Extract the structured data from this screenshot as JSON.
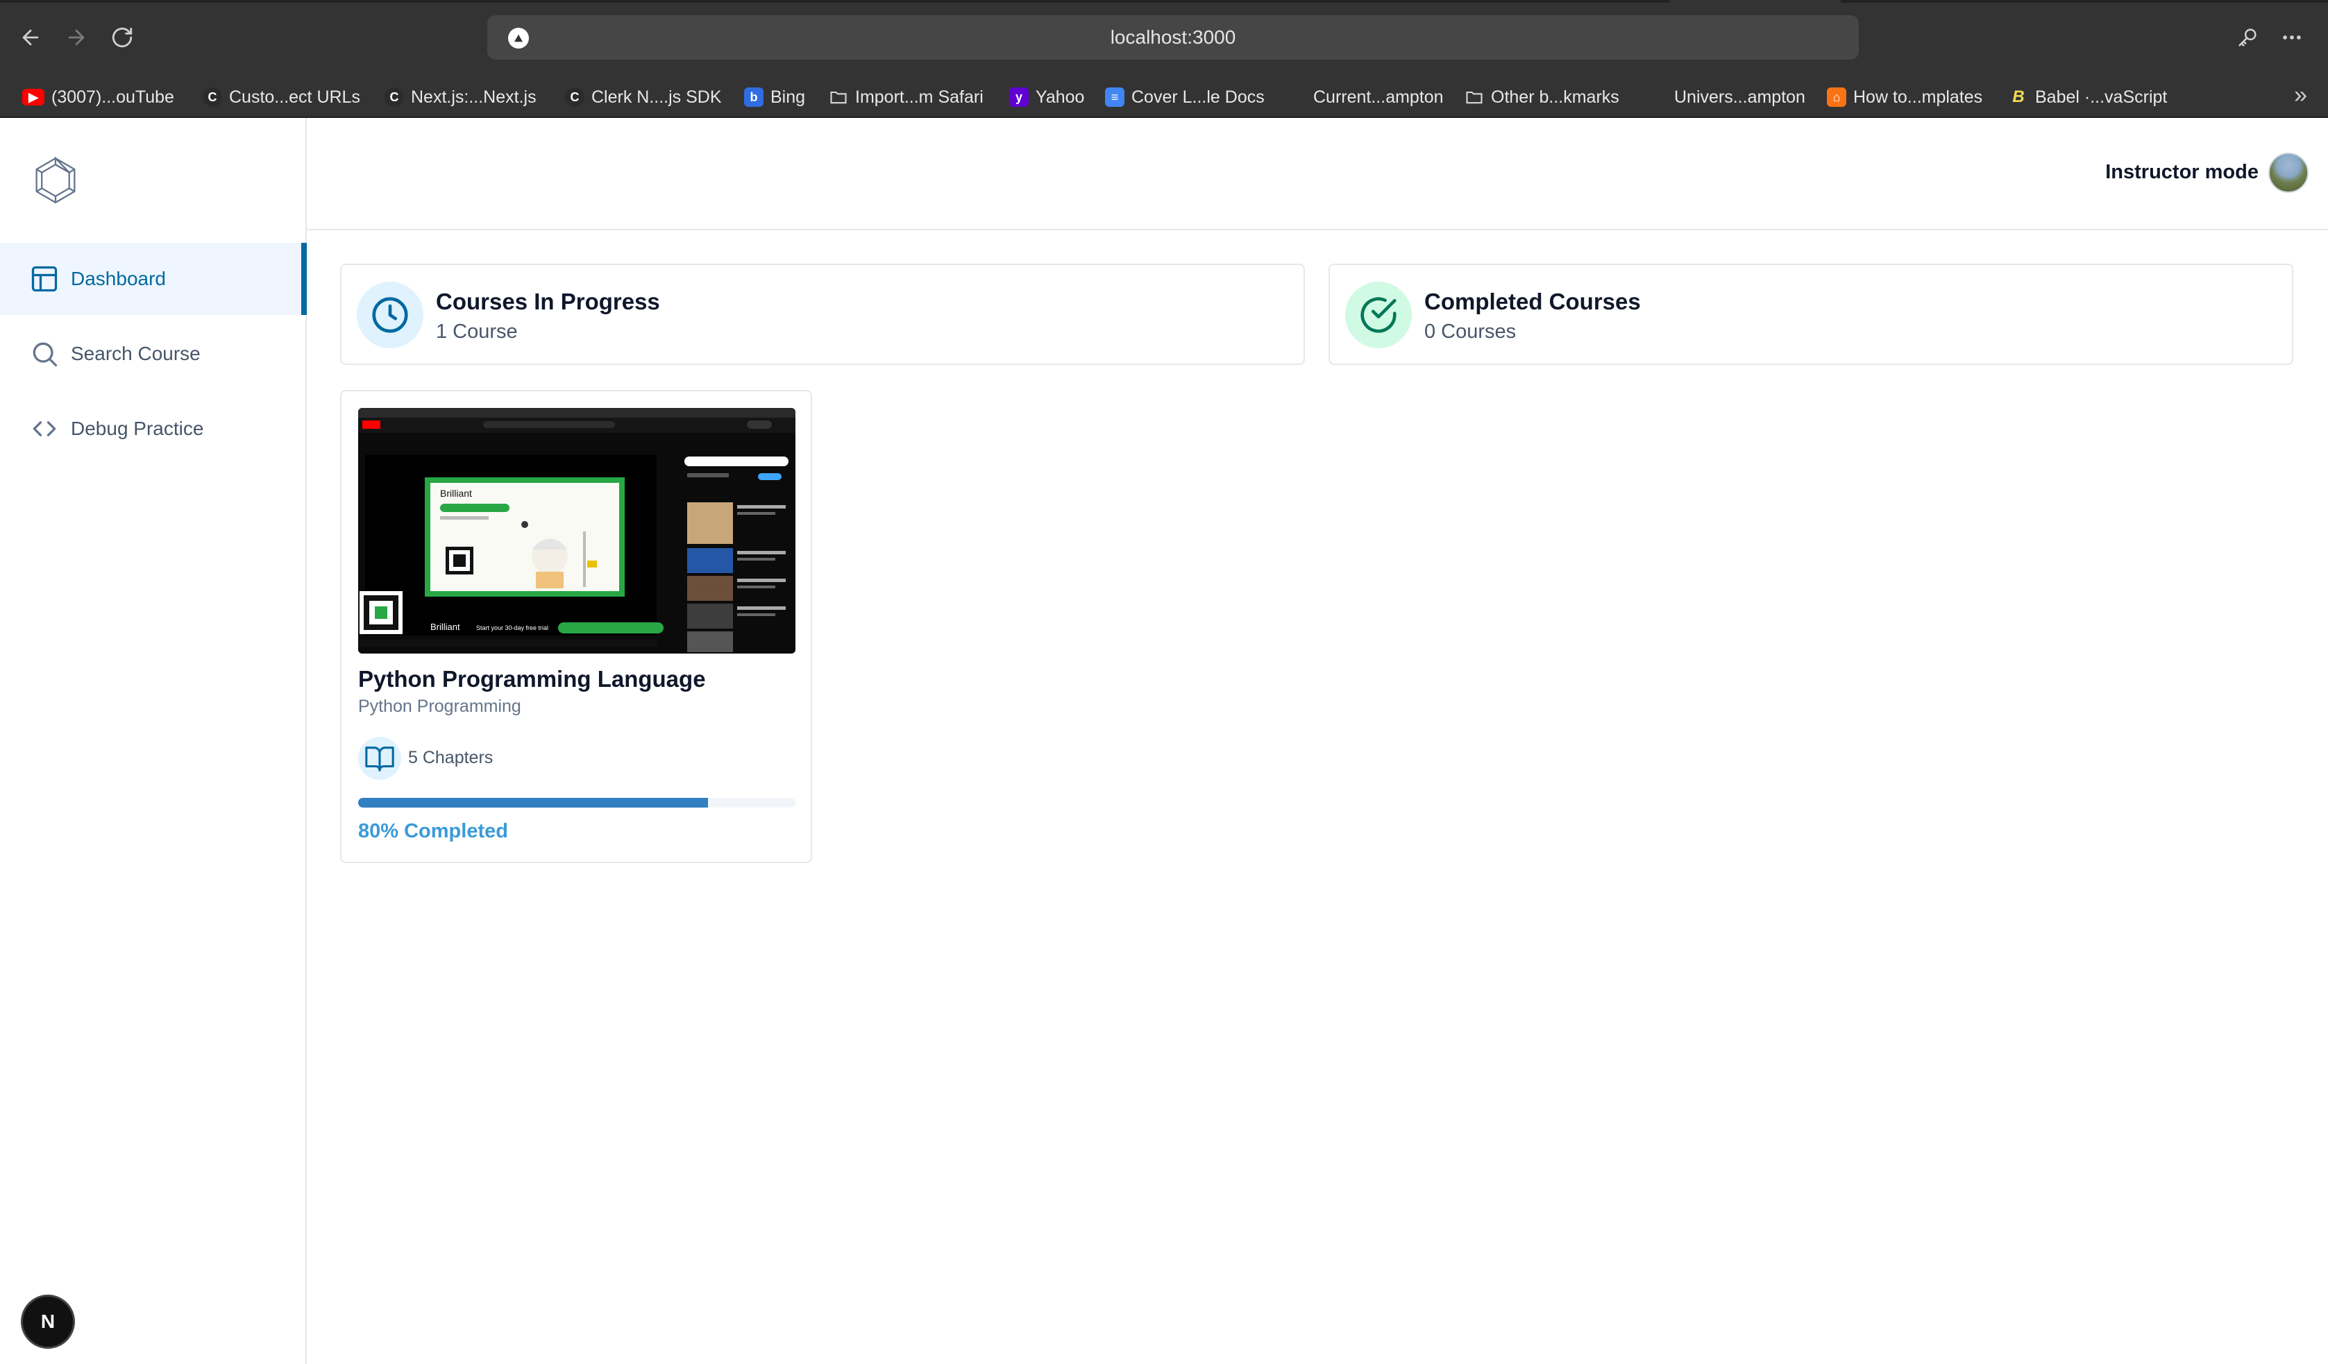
{
  "browser": {
    "url": "localhost:3000",
    "bookmarks": [
      {
        "label": "(3007)...ouTube",
        "icon": "youtube-icon",
        "color": "#ff0000"
      },
      {
        "label": "Custo...ect URLs",
        "icon": "clerk-icon",
        "color": "#444444"
      },
      {
        "label": "Next.js:...Next.js",
        "icon": "clerk-icon",
        "color": "#444444"
      },
      {
        "label": "Clerk N....js SDK",
        "icon": "clerk-icon",
        "color": "#444444"
      },
      {
        "label": "Bing",
        "icon": "bing-icon",
        "color": "#2f6de0"
      },
      {
        "label": "Import...m Safari",
        "icon": "folder-icon",
        "color": ""
      },
      {
        "label": "Yahoo",
        "icon": "yahoo-icon",
        "color": "#6001d2"
      },
      {
        "label": "Cover L...le Docs",
        "icon": "docs-icon",
        "color": "#4285f4"
      },
      {
        "label": "Current...ampton",
        "icon": "",
        "color": ""
      },
      {
        "label": "Other b...kmarks",
        "icon": "folder-icon",
        "color": ""
      },
      {
        "label": "Univers...ampton",
        "icon": "",
        "color": ""
      },
      {
        "label": "How to...mplates",
        "icon": "orange-site-icon",
        "color": "#f97316"
      },
      {
        "label": "Babel ·...vaScript",
        "icon": "babel-icon",
        "color": "#f5da55"
      }
    ]
  },
  "sidebar": {
    "items": [
      {
        "label": "Dashboard",
        "icon": "layout-icon",
        "active": true
      },
      {
        "label": "Search Course",
        "icon": "search-icon",
        "active": false
      },
      {
        "label": "Debug Practice",
        "icon": "code-icon",
        "active": false
      }
    ],
    "badge": "N"
  },
  "header": {
    "instructor_label": "Instructor mode"
  },
  "stats": {
    "in_progress": {
      "title": "Courses In Progress",
      "count": "1 Course",
      "color": "#0369a1",
      "bg": "#e0f2fe"
    },
    "completed": {
      "title": "Completed Courses",
      "count": "0 Courses",
      "color": "#047857",
      "bg": "#d1fae5"
    }
  },
  "course": {
    "title": "Python Programming Language",
    "category": "Python Programming",
    "chapters": "5 Chapters",
    "progress_percent": 80,
    "progress_label": "80% Completed",
    "thumbnail": {
      "promo_title": "Brilliant",
      "promo_cta": "Start your 30-day free trial",
      "channel": "YouTube"
    }
  },
  "colors": {
    "accent": "#0369a1",
    "progress": "#2f7fc1",
    "progress_text": "#3b9ad9"
  }
}
